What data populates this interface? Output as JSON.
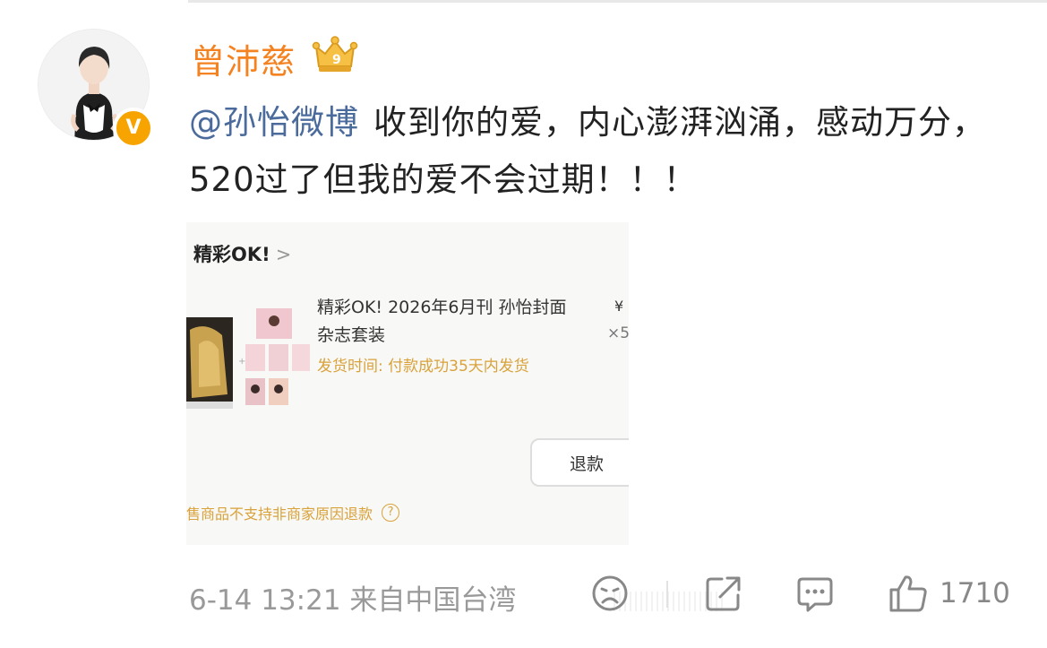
{
  "post": {
    "author": "曾沛慈",
    "mention": "@孙怡微博",
    "text": "收到你的爱，内心澎湃汹涌，感动万分，520过了但我的爱不会过期！！！",
    "vip_badge": "crown-vip-9-icon",
    "verified_badge": "V"
  },
  "embedded_card": {
    "shop_name": "精彩OK!",
    "shop_arrow": ">",
    "product_title": "精彩OK! 2026年6月刊 孙怡封面杂志套装",
    "shipping": "发货时间: 付款成功35天内发货",
    "price": "¥",
    "quantity": "×5",
    "refund_button": "退款",
    "notice": "售商品不支持非商家原因退款",
    "help_icon": "?"
  },
  "footer": {
    "meta": "6-14 13:21 来自中国台湾",
    "like_count": "1710"
  },
  "colors": {
    "author": "#f58220",
    "mention": "#4a6b9c",
    "verified": "#f7a400",
    "shipping": "#d9a23a"
  }
}
